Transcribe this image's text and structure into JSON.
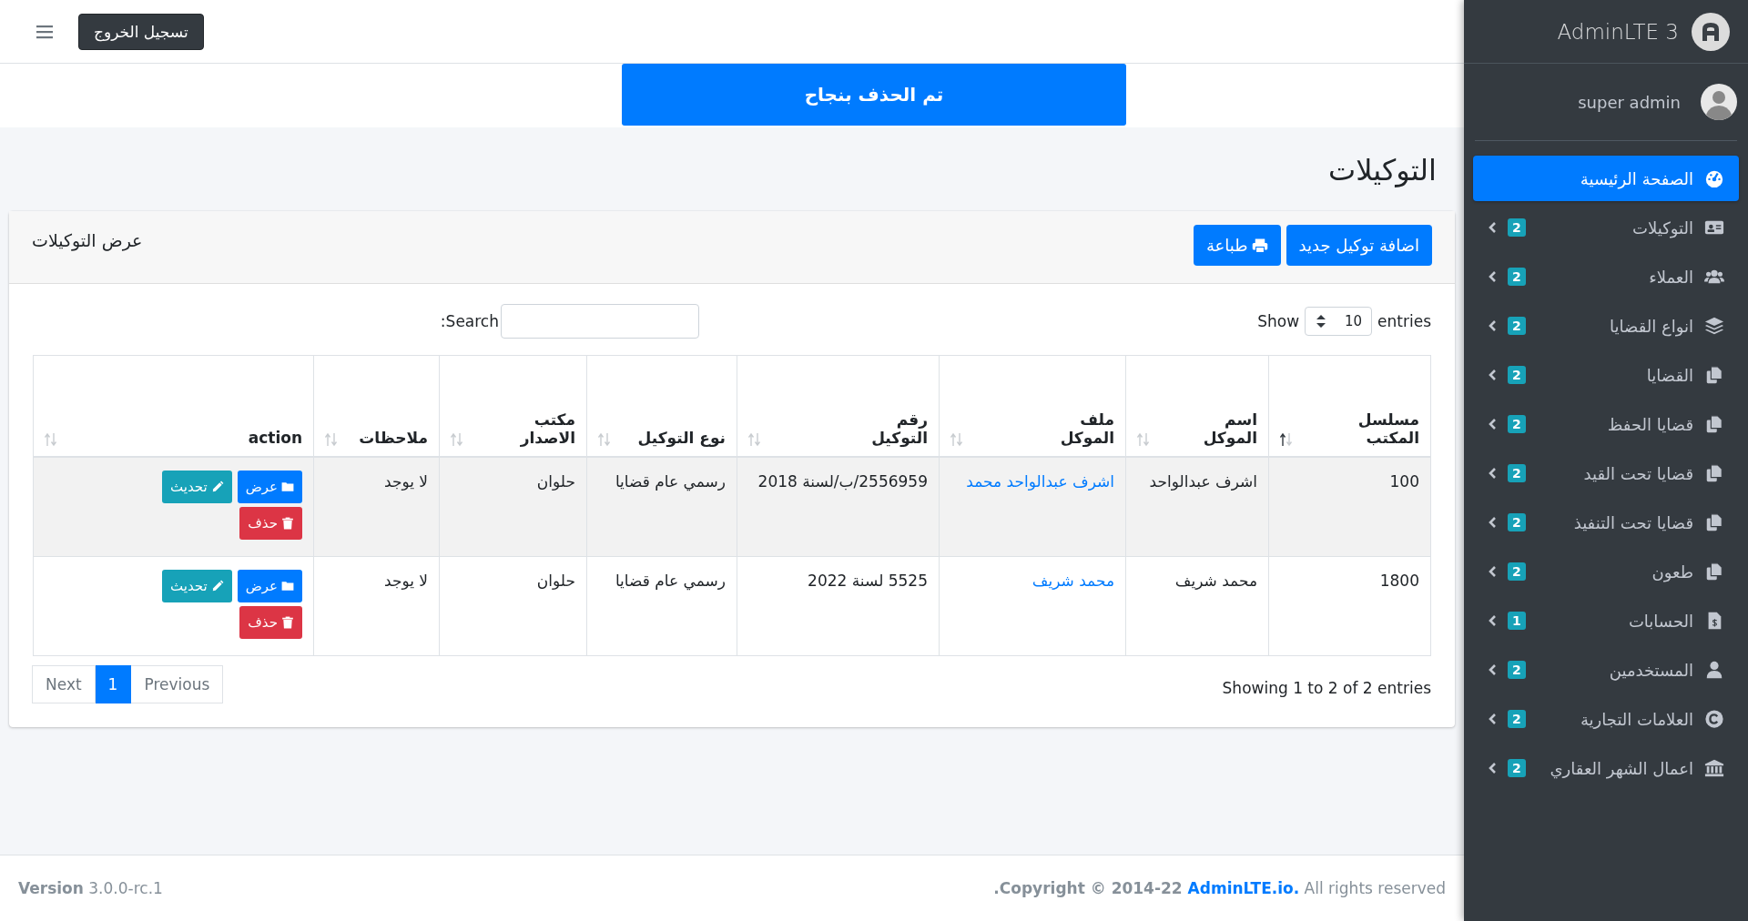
{
  "topbar": {
    "logout_button": "تسجيل الخروج"
  },
  "alert": {
    "message": "تم الحذف بنجاح"
  },
  "page_title": "التوكيلات",
  "card": {
    "title": "عرض التوكيلات",
    "buttons": [
      {
        "label": "اضافة توكيل جديد",
        "kind": "add"
      },
      {
        "label": "طباعة",
        "kind": "print"
      }
    ]
  },
  "table_controls": {
    "show_label": "Show",
    "page_size": "10",
    "entries_label": "entries",
    "search_label": ":Search"
  },
  "table": {
    "columns": [
      {
        "label": "مسلسل المكتب",
        "sorted": true,
        "kind": "text"
      },
      {
        "label": "اسم الموكل",
        "sorted": false,
        "kind": "text"
      },
      {
        "label": "ملف الموكل",
        "sorted": false,
        "kind": "link"
      },
      {
        "label": "رقم التوكيل",
        "sorted": false,
        "kind": "text"
      },
      {
        "label": "نوع التوكيل",
        "sorted": false,
        "kind": "text"
      },
      {
        "label": "مكتب الاصدار",
        "sorted": false,
        "kind": "text"
      },
      {
        "label": "ملاحظات",
        "sorted": false,
        "kind": "text"
      },
      {
        "label": "action",
        "sorted": false,
        "kind": "actions"
      }
    ],
    "rows": [
      {
        "cells": [
          "100",
          "اشرف عبدالواحد",
          "اشرف عبدالواحد محمد",
          "2556959/ب/لسنة 2018",
          "رسمي عام قضايا",
          "حلوان",
          "لا يوجد"
        ],
        "actions": [
          {
            "label": "عرض",
            "kind": "view"
          },
          {
            "label": "تحديث",
            "kind": "edit"
          },
          {
            "label": "حذف",
            "kind": "delete"
          }
        ]
      },
      {
        "cells": [
          "1800",
          "محمد شريف",
          "محمد شريف",
          "5525 لسنة 2022",
          "رسمي عام قضايا",
          "حلوان",
          "لا يوجد"
        ],
        "actions": [
          {
            "label": "عرض",
            "kind": "view"
          },
          {
            "label": "تحديث",
            "kind": "edit"
          },
          {
            "label": "حذف",
            "kind": "delete"
          }
        ]
      }
    ]
  },
  "table_info": "Showing 1 to 2 of 2 entries",
  "pagination": [
    {
      "label": "Previous",
      "selected": false
    },
    {
      "label": "1",
      "selected": true
    },
    {
      "label": "Next",
      "selected": false
    }
  ],
  "footer": {
    "copyright": ".Copyright © 2014-22",
    "link": "AdminLTE.io.",
    "rights": "All rights reserved",
    "version_label": "Version",
    "version": "3.0.0-rc.1"
  },
  "sidebar": {
    "brand": "AdminLTE 3",
    "user": "super admin",
    "items": [
      {
        "label": "الصفحة الرئيسية",
        "kind": "dashboard",
        "selected": true
      },
      {
        "label": "التوكيلات",
        "kind": "idcard",
        "badge": "2",
        "selected": false
      },
      {
        "label": "العملاء",
        "kind": "users",
        "badge": "2",
        "selected": false
      },
      {
        "label": "انواع القضايا",
        "kind": "layers",
        "badge": "2",
        "selected": false
      },
      {
        "label": "القضايا",
        "kind": "copy",
        "badge": "2",
        "selected": false
      },
      {
        "label": "قضايا الحفظ",
        "kind": "copy",
        "badge": "2",
        "selected": false
      },
      {
        "label": "قضايا تحت القيد",
        "kind": "copy",
        "badge": "2",
        "selected": false
      },
      {
        "label": "قضايا تحت التنفيذ",
        "kind": "copy",
        "badge": "2",
        "selected": false
      },
      {
        "label": "طعون",
        "kind": "copy",
        "badge": "2",
        "selected": false
      },
      {
        "label": "الحسابات",
        "kind": "invoice",
        "badge": "1",
        "selected": false
      },
      {
        "label": "المستخدمين",
        "kind": "user",
        "badge": "2",
        "selected": false
      },
      {
        "label": "العلامات التجارية",
        "kind": "copyright",
        "badge": "2",
        "selected": false
      },
      {
        "label": "اعمال الشهر العقاري",
        "kind": "bank",
        "badge": "2",
        "selected": false
      }
    ]
  }
}
